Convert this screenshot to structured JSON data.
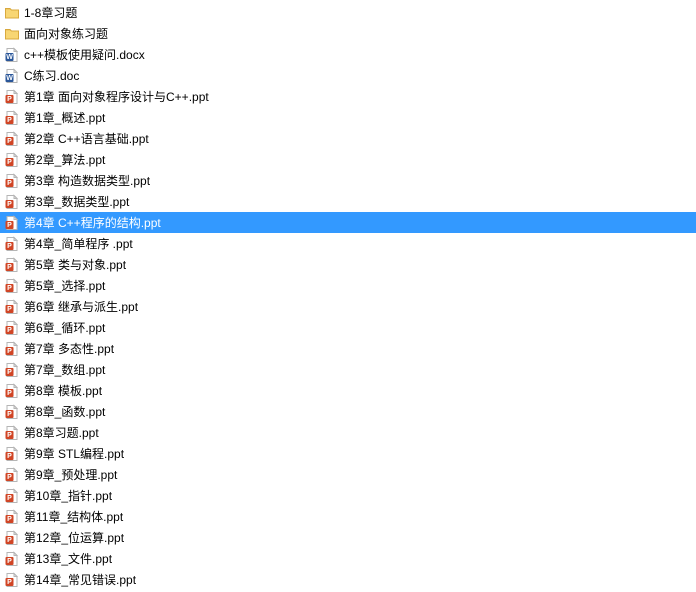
{
  "files": [
    {
      "name": "1-8章习题",
      "type": "folder",
      "selected": false
    },
    {
      "name": "面向对象练习题",
      "type": "folder",
      "selected": false
    },
    {
      "name": "c++模板使用疑问.docx",
      "type": "docx",
      "selected": false
    },
    {
      "name": "C练习.doc",
      "type": "doc",
      "selected": false
    },
    {
      "name": "第1章 面向对象程序设计与C++.ppt",
      "type": "ppt",
      "selected": false
    },
    {
      "name": "第1章_概述.ppt",
      "type": "ppt",
      "selected": false
    },
    {
      "name": "第2章 C++语言基础.ppt",
      "type": "ppt",
      "selected": false
    },
    {
      "name": "第2章_算法.ppt",
      "type": "ppt",
      "selected": false
    },
    {
      "name": "第3章 构造数据类型.ppt",
      "type": "ppt",
      "selected": false
    },
    {
      "name": "第3章_数据类型.ppt",
      "type": "ppt",
      "selected": false
    },
    {
      "name": "第4章 C++程序的结构.ppt",
      "type": "ppt",
      "selected": true
    },
    {
      "name": "第4章_简单程序 .ppt",
      "type": "ppt",
      "selected": false
    },
    {
      "name": "第5章 类与对象.ppt",
      "type": "ppt",
      "selected": false
    },
    {
      "name": "第5章_选择.ppt",
      "type": "ppt",
      "selected": false
    },
    {
      "name": "第6章 继承与派生.ppt",
      "type": "ppt",
      "selected": false
    },
    {
      "name": "第6章_循环.ppt",
      "type": "ppt",
      "selected": false
    },
    {
      "name": "第7章 多态性.ppt",
      "type": "ppt",
      "selected": false
    },
    {
      "name": "第7章_数组.ppt",
      "type": "ppt",
      "selected": false
    },
    {
      "name": "第8章 模板.ppt",
      "type": "ppt",
      "selected": false
    },
    {
      "name": "第8章_函数.ppt",
      "type": "ppt",
      "selected": false
    },
    {
      "name": "第8章习题.ppt",
      "type": "ppt",
      "selected": false
    },
    {
      "name": "第9章 STL编程.ppt",
      "type": "ppt",
      "selected": false
    },
    {
      "name": "第9章_预处理.ppt",
      "type": "ppt",
      "selected": false
    },
    {
      "name": "第10章_指针.ppt",
      "type": "ppt",
      "selected": false
    },
    {
      "name": "第11章_结构体.ppt",
      "type": "ppt",
      "selected": false
    },
    {
      "name": "第12章_位运算.ppt",
      "type": "ppt",
      "selected": false
    },
    {
      "name": "第13章_文件.ppt",
      "type": "ppt",
      "selected": false
    },
    {
      "name": "第14章_常见错误.ppt",
      "type": "ppt",
      "selected": false
    }
  ],
  "colors": {
    "selection_bg": "#3399ff",
    "selection_fg": "#ffffff",
    "folder_fill": "#f8d673",
    "folder_stroke": "#d9a93e",
    "ppt_accent": "#d04525",
    "doc_accent": "#2a5699",
    "page_fill": "#ffffff",
    "page_stroke": "#b5b5b5"
  }
}
